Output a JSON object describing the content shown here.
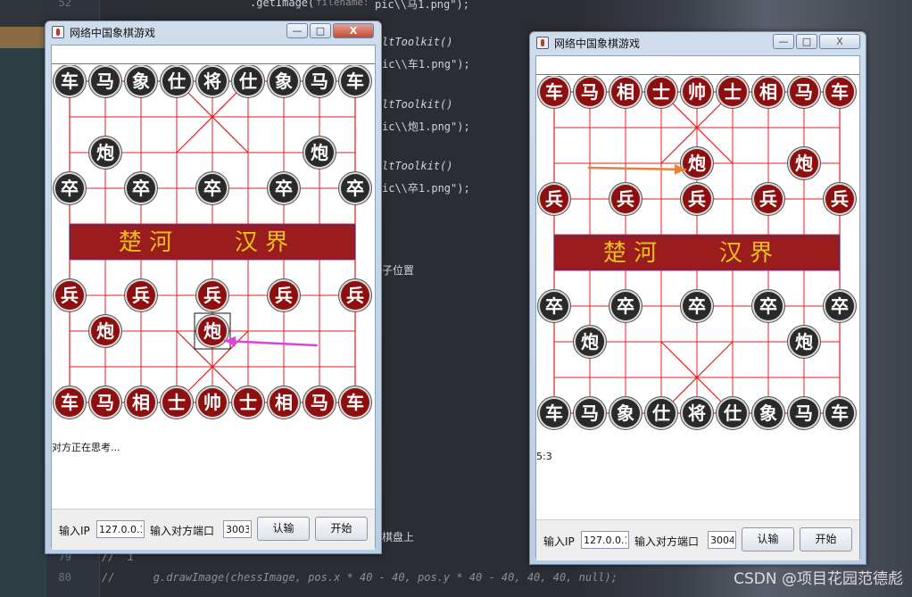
{
  "editor": {
    "code_lines": [
      {
        "text": ".getImage(",
        "italic": false
      },
      {
        "text": "filename:",
        "italic": false
      },
      {
        "text": "pic\\\\马1.png\");",
        "italic": false
      },
      {
        "text": "ltToolkit()",
        "italic": true
      },
      {
        "text": "ic\\\\车1.png\");",
        "italic": false
      },
      {
        "text": "ltToolkit()",
        "italic": true
      },
      {
        "text": "ic\\\\炮1.png\");",
        "italic": false
      },
      {
        "text": "ltToolkit()",
        "italic": true
      },
      {
        "text": "ic\\\\卒1.png\");",
        "italic": false
      },
      {
        "text": "子位置",
        "italic": false
      },
      {
        "text": "棋盘上",
        "italic": false
      },
      {
        "text": "//  i",
        "italic": true
      },
      {
        "text": "//      g.drawImage(chessImage, pos.x * 40 - 40, pos.y * 40 - 40, 40, 40, null);",
        "italic": true
      }
    ],
    "line_numbers": [
      "52",
      "79",
      "80"
    ],
    "watermark": "CSDN @项目花园范德彪"
  },
  "window_left": {
    "title": "网络中国象棋游戏",
    "controls": {
      "minimize": "—",
      "maximize": "□",
      "close": "X"
    },
    "river_left": "楚 河",
    "river_right": "汉 界",
    "status": "对方正在思考...",
    "ip_label": "输入IP",
    "ip_value": "127.0.0.1",
    "port_label": "输入对方端口",
    "port_value": "3003",
    "concede_button": "认输",
    "start_button": "开始",
    "pieces": [
      {
        "ch": "车",
        "color": "black",
        "col": 0,
        "row": 0
      },
      {
        "ch": "马",
        "color": "black",
        "col": 1,
        "row": 0
      },
      {
        "ch": "象",
        "color": "black",
        "col": 2,
        "row": 0
      },
      {
        "ch": "仕",
        "color": "black",
        "col": 3,
        "row": 0
      },
      {
        "ch": "将",
        "color": "black",
        "col": 4,
        "row": 0
      },
      {
        "ch": "仕",
        "color": "black",
        "col": 5,
        "row": 0
      },
      {
        "ch": "象",
        "color": "black",
        "col": 6,
        "row": 0
      },
      {
        "ch": "马",
        "color": "black",
        "col": 7,
        "row": 0
      },
      {
        "ch": "车",
        "color": "black",
        "col": 8,
        "row": 0
      },
      {
        "ch": "炮",
        "color": "black",
        "col": 1,
        "row": 2
      },
      {
        "ch": "炮",
        "color": "black",
        "col": 7,
        "row": 2
      },
      {
        "ch": "卒",
        "color": "black",
        "col": 0,
        "row": 3
      },
      {
        "ch": "卒",
        "color": "black",
        "col": 2,
        "row": 3
      },
      {
        "ch": "卒",
        "color": "black",
        "col": 4,
        "row": 3
      },
      {
        "ch": "卒",
        "color": "black",
        "col": 6,
        "row": 3
      },
      {
        "ch": "卒",
        "color": "black",
        "col": 8,
        "row": 3
      },
      {
        "ch": "兵",
        "color": "red",
        "col": 0,
        "row": 6
      },
      {
        "ch": "兵",
        "color": "red",
        "col": 2,
        "row": 6
      },
      {
        "ch": "兵",
        "color": "red",
        "col": 4,
        "row": 6
      },
      {
        "ch": "兵",
        "color": "red",
        "col": 6,
        "row": 6
      },
      {
        "ch": "兵",
        "color": "red",
        "col": 8,
        "row": 6
      },
      {
        "ch": "炮",
        "color": "red",
        "col": 1,
        "row": 7
      },
      {
        "ch": "炮",
        "color": "red",
        "col": 4,
        "row": 7,
        "selected": true
      },
      {
        "ch": "车",
        "color": "red",
        "col": 0,
        "row": 9
      },
      {
        "ch": "马",
        "color": "red",
        "col": 1,
        "row": 9
      },
      {
        "ch": "相",
        "color": "red",
        "col": 2,
        "row": 9
      },
      {
        "ch": "士",
        "color": "red",
        "col": 3,
        "row": 9
      },
      {
        "ch": "帅",
        "color": "red",
        "col": 4,
        "row": 9
      },
      {
        "ch": "士",
        "color": "red",
        "col": 5,
        "row": 9
      },
      {
        "ch": "相",
        "color": "red",
        "col": 6,
        "row": 9
      },
      {
        "ch": "马",
        "color": "red",
        "col": 7,
        "row": 9
      },
      {
        "ch": "车",
        "color": "red",
        "col": 8,
        "row": 9
      }
    ]
  },
  "window_right": {
    "title": "网络中国象棋游戏",
    "controls": {
      "minimize": "—",
      "maximize": "□",
      "close": "X"
    },
    "river_left": "楚 河",
    "river_right": "汉 界",
    "status": "5:3",
    "ip_label": "输入IP",
    "ip_value": "127.0.0.1",
    "port_label": "输入对方端口",
    "port_value": "3004",
    "concede_button": "认输",
    "start_button": "开始",
    "pieces": [
      {
        "ch": "车",
        "color": "red",
        "col": 0,
        "row": 0
      },
      {
        "ch": "马",
        "color": "red",
        "col": 1,
        "row": 0
      },
      {
        "ch": "相",
        "color": "red",
        "col": 2,
        "row": 0
      },
      {
        "ch": "士",
        "color": "red",
        "col": 3,
        "row": 0
      },
      {
        "ch": "帅",
        "color": "red",
        "col": 4,
        "row": 0
      },
      {
        "ch": "士",
        "color": "red",
        "col": 5,
        "row": 0
      },
      {
        "ch": "相",
        "color": "red",
        "col": 6,
        "row": 0
      },
      {
        "ch": "马",
        "color": "red",
        "col": 7,
        "row": 0
      },
      {
        "ch": "车",
        "color": "red",
        "col": 8,
        "row": 0
      },
      {
        "ch": "炮",
        "color": "red",
        "col": 4,
        "row": 2
      },
      {
        "ch": "炮",
        "color": "red",
        "col": 7,
        "row": 2
      },
      {
        "ch": "兵",
        "color": "red",
        "col": 0,
        "row": 3
      },
      {
        "ch": "兵",
        "color": "red",
        "col": 2,
        "row": 3
      },
      {
        "ch": "兵",
        "color": "red",
        "col": 4,
        "row": 3
      },
      {
        "ch": "兵",
        "color": "red",
        "col": 6,
        "row": 3
      },
      {
        "ch": "兵",
        "color": "red",
        "col": 8,
        "row": 3
      },
      {
        "ch": "卒",
        "color": "black",
        "col": 0,
        "row": 6
      },
      {
        "ch": "卒",
        "color": "black",
        "col": 2,
        "row": 6
      },
      {
        "ch": "卒",
        "color": "black",
        "col": 4,
        "row": 6
      },
      {
        "ch": "卒",
        "color": "black",
        "col": 6,
        "row": 6
      },
      {
        "ch": "卒",
        "color": "black",
        "col": 8,
        "row": 6
      },
      {
        "ch": "炮",
        "color": "black",
        "col": 1,
        "row": 7
      },
      {
        "ch": "炮",
        "color": "black",
        "col": 7,
        "row": 7
      },
      {
        "ch": "车",
        "color": "black",
        "col": 0,
        "row": 9
      },
      {
        "ch": "马",
        "color": "black",
        "col": 1,
        "row": 9
      },
      {
        "ch": "象",
        "color": "black",
        "col": 2,
        "row": 9
      },
      {
        "ch": "仕",
        "color": "black",
        "col": 3,
        "row": 9
      },
      {
        "ch": "将",
        "color": "black",
        "col": 4,
        "row": 9
      },
      {
        "ch": "仕",
        "color": "black",
        "col": 5,
        "row": 9
      },
      {
        "ch": "象",
        "color": "black",
        "col": 6,
        "row": 9
      },
      {
        "ch": "马",
        "color": "black",
        "col": 7,
        "row": 9
      },
      {
        "ch": "车",
        "color": "black",
        "col": 8,
        "row": 9
      }
    ]
  },
  "colors": {
    "board_line": "#e02020",
    "river_band": "#9b1c1c",
    "river_text": "#e8c020",
    "piece_red": "#8e0f0f",
    "piece_black": "#2a2a2a",
    "arrow_left": "#e040e0",
    "arrow_right": "#e8803a"
  }
}
